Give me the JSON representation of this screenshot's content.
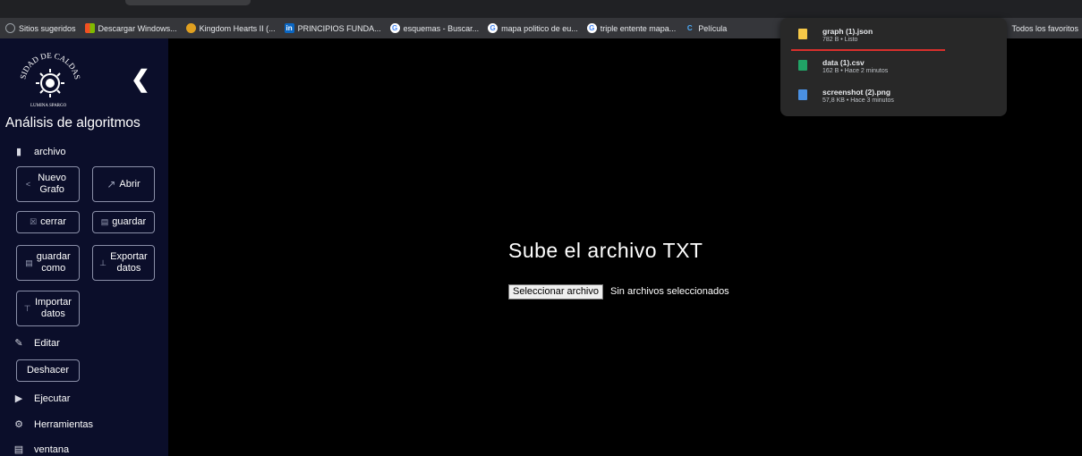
{
  "bookmarks": [
    {
      "label": "Sitios sugeridos",
      "icon": "globe-icon",
      "color": "#9aa0a6"
    },
    {
      "label": "Descargar Windows...",
      "icon": "windows-icon",
      "color": "#f25022"
    },
    {
      "label": "Kingdom Hearts II (...",
      "icon": "kingdom-hearts-icon",
      "color": "#e0a020"
    },
    {
      "label": "PRINCIPIOS FUNDA...",
      "icon": "linkedin-icon",
      "color": "#0a66c2"
    },
    {
      "label": "esquemas - Buscar...",
      "icon": "google-icon",
      "color": "#4285f4"
    },
    {
      "label": "mapa politico de eu...",
      "icon": "google-icon",
      "color": "#4285f4"
    },
    {
      "label": "triple entente mapa...",
      "icon": "google-icon",
      "color": "#4285f4"
    },
    {
      "label": "Película",
      "icon": "c-icon",
      "color": "#1a73e8"
    }
  ],
  "bookmarks_all": "Todos los favoritos",
  "sidebar": {
    "title": "Análisis de algoritmos",
    "file_menu": "archivo",
    "btn_new_graph": "Nuevo Grafo",
    "btn_open": "Abrir",
    "btn_close": "cerrar",
    "btn_save": "guardar",
    "btn_save_as": "guardar como",
    "btn_export": "Exportar datos",
    "btn_import": "Importar datos",
    "edit_menu": "Editar",
    "btn_undo": "Deshacer",
    "run_menu": "Ejecutar",
    "tools_menu": "Herramientas",
    "window_menu": "ventana"
  },
  "main": {
    "upload_title": "Sube el archivo TXT",
    "file_button": "Seleccionar archivo",
    "file_status": "Sin archivos seleccionados"
  },
  "downloads": [
    {
      "name": "graph (1).json",
      "meta": "782 B • Listo",
      "icon": "json-file-icon",
      "color": "#f7c948"
    },
    {
      "name": "data (1).csv",
      "meta": "162 B • Hace 2 minutos",
      "icon": "csv-file-icon",
      "color": "#21a366"
    },
    {
      "name": "screenshot (2).png",
      "meta": "57,8 KB • Hace 3 minutos",
      "icon": "png-file-icon",
      "color": "#4a90e2"
    }
  ],
  "colors": {
    "sidebar_bg": "#0b0e2a",
    "main_bg": "#000000",
    "accent_red": "#d9302c"
  }
}
